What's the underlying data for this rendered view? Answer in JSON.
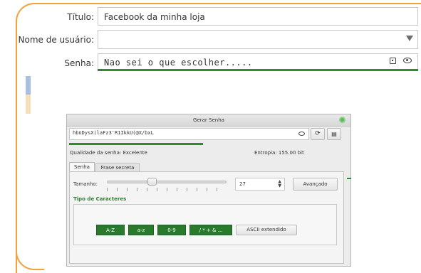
{
  "form": {
    "title_label": "Título:",
    "title_value": "Facebook da minha loja",
    "username_label": "Nome de usuário:",
    "username_value": "",
    "password_label": "Senha:",
    "password_value": "Nao sei o que escolher....."
  },
  "dialog": {
    "title": "Gerar Senha",
    "generated_password": "hbnDysX(laFz3'R1IkkU(@X/bxL",
    "quality_text": "Qualidade da senha: Excelente",
    "entropy_text": "Entropia: 155.00 bit",
    "tabs": [
      "Senha",
      "Frase secreta"
    ],
    "length_label": "Tamanho:",
    "length_value": "27",
    "advanced_label": "Avançado",
    "char_types_title": "Tipo de Caracteres",
    "char_buttons": [
      "A-Z",
      "a-z",
      "0-9",
      "/ * + & ...",
      "ASCII extendido"
    ]
  },
  "colors": {
    "accent_orange": "#f5a13a",
    "strength_green": "#2e8b2e",
    "active_button_green": "#2a7a2e"
  }
}
